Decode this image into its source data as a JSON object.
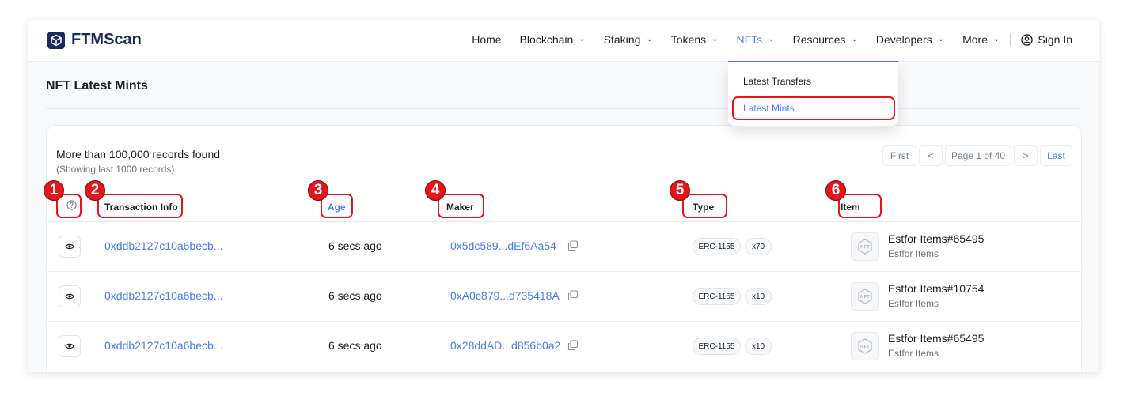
{
  "brand": {
    "name": "FTMScan",
    "color": "#1b2c5c"
  },
  "nav": {
    "items": [
      {
        "label": "Home",
        "has_menu": false
      },
      {
        "label": "Blockchain",
        "has_menu": true
      },
      {
        "label": "Staking",
        "has_menu": true
      },
      {
        "label": "Tokens",
        "has_menu": true
      },
      {
        "label": "NFTs",
        "has_menu": true,
        "active": true
      },
      {
        "label": "Resources",
        "has_menu": true
      },
      {
        "label": "Developers",
        "has_menu": true
      },
      {
        "label": "More",
        "has_menu": true
      }
    ],
    "sign_in": "Sign In",
    "accent": "#4a7cf7"
  },
  "dropdown": {
    "items": [
      {
        "label": "Latest Transfers",
        "active": false
      },
      {
        "label": "Latest Mints",
        "active": true
      }
    ]
  },
  "page": {
    "title": "NFT Latest Mints"
  },
  "summary": {
    "records": "More than 100,000 records found",
    "showing": "(Showing last 1000 records)"
  },
  "pagination": {
    "first": "First",
    "prev": "<",
    "page": "Page 1 of 40",
    "next": ">",
    "last": "Last"
  },
  "table": {
    "headers": {
      "transaction": "Transaction Info",
      "age": "Age",
      "maker": "Maker",
      "type": "Type",
      "item": "Item"
    },
    "rows": [
      {
        "tx": "0xddb2127c10a6becb...",
        "age": "6 secs ago",
        "maker": "0x5dc589...dEf6Aa54",
        "token_type": "ERC-1155",
        "qty": "x70",
        "item": "Estfor Items#65495",
        "collection": "Estfor Items"
      },
      {
        "tx": "0xddb2127c10a6becb...",
        "age": "6 secs ago",
        "maker": "0xA0c879...d735418A",
        "token_type": "ERC-1155",
        "qty": "x10",
        "item": "Estfor Items#10754",
        "collection": "Estfor Items"
      },
      {
        "tx": "0xddb2127c10a6becb...",
        "age": "6 secs ago",
        "maker": "0x28ddAD...d856b0a2",
        "token_type": "ERC-1155",
        "qty": "x10",
        "item": "Estfor Items#65495",
        "collection": "Estfor Items"
      }
    ]
  },
  "nft_icon_label": "NFT",
  "annotations": {
    "numbers": [
      "1",
      "2",
      "3",
      "4",
      "5",
      "6"
    ],
    "highlight_color": "#e8141c"
  }
}
